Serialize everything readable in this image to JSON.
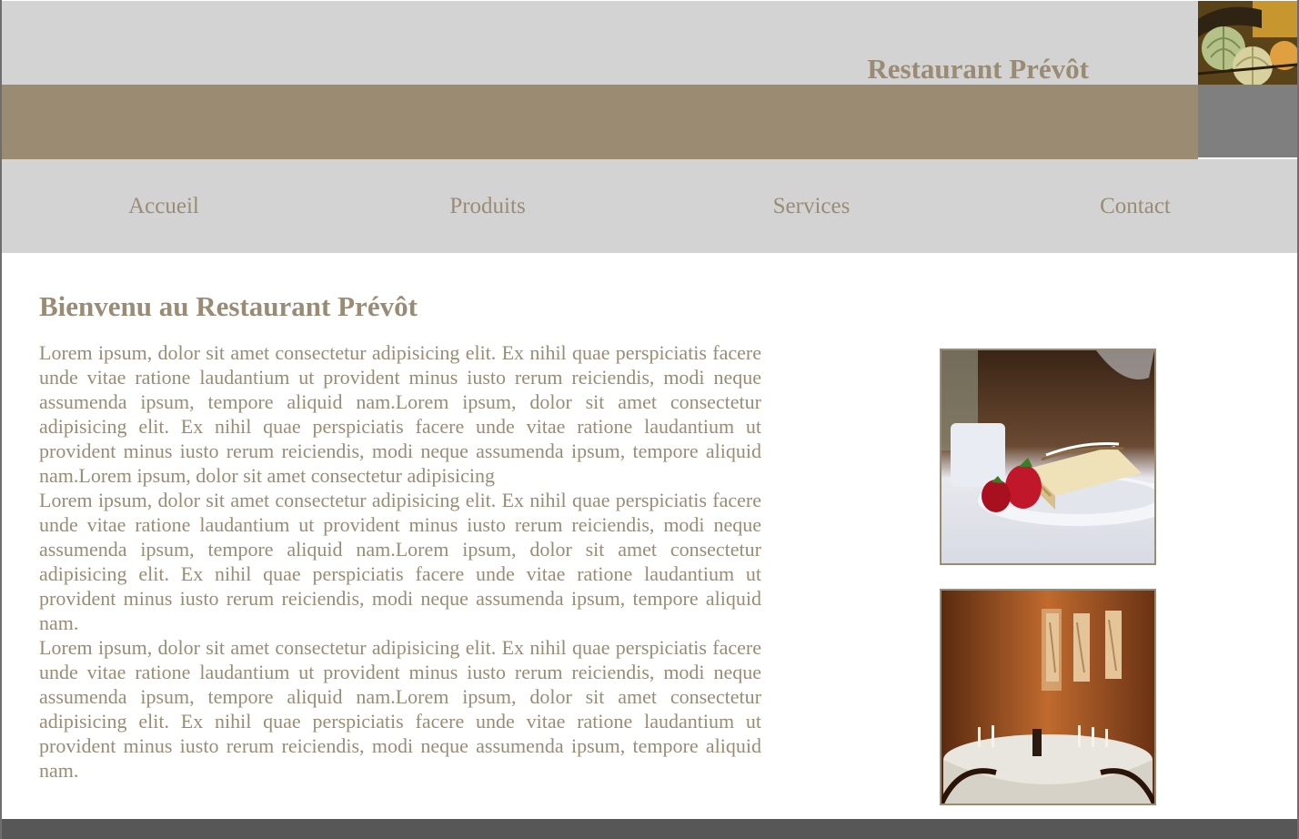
{
  "header": {
    "brand_title": "Restaurant Prévôt",
    "logo_image": "melons-basket-photo"
  },
  "nav": {
    "items": [
      {
        "label": "Accueil"
      },
      {
        "label": "Produits"
      },
      {
        "label": "Services"
      },
      {
        "label": "Contact"
      }
    ]
  },
  "main": {
    "title": "Bienvenu au Restaurant Prévôt",
    "paragraphs": [
      "Lorem ipsum, dolor sit amet consectetur adipisicing elit. Ex nihil quae perspiciatis facere unde vitae ratione laudantium ut provident minus iusto rerum reiciendis, modi neque assumenda ipsum, tempore aliquid nam.Lorem ipsum, dolor sit amet consectetur adipisicing elit. Ex nihil quae perspiciatis facere unde vitae ratione laudantium ut provident minus iusto rerum reiciendis, modi neque assumenda ipsum, tempore aliquid nam.Lorem ipsum, dolor sit amet consectetur adipisicing",
      "Lorem ipsum, dolor sit amet consectetur adipisicing elit. Ex nihil quae perspiciatis facere unde vitae ratione laudantium ut provident minus iusto rerum reiciendis, modi neque assumenda ipsum, tempore aliquid nam.Lorem ipsum, dolor sit amet consectetur adipisicing elit. Ex nihil quae perspiciatis facere unde vitae ratione laudantium ut provident minus iusto rerum reiciendis, modi neque assumenda ipsum, tempore aliquid nam.",
      "Lorem ipsum, dolor sit amet consectetur adipisicing elit. Ex nihil quae perspiciatis facere unde vitae ratione laudantium ut provident minus iusto rerum reiciendis, modi neque assumenda ipsum, tempore aliquid nam.Lorem ipsum, dolor sit amet consectetur adipisicing elit. Ex nihil quae perspiciatis facere unde vitae ratione laudantium ut provident minus iusto rerum reiciendis, modi neque assumenda ipsum, tempore aliquid nam."
    ]
  },
  "images": {
    "dessert": "strawberry-cake-photo",
    "dining": "dining-room-photo"
  },
  "colors": {
    "accent_text": "#9a8c74",
    "band_gray": "#d3d3d3",
    "band_brown": "#9a8b72",
    "block_gray": "#7f7f7f",
    "footer": "#575757"
  }
}
